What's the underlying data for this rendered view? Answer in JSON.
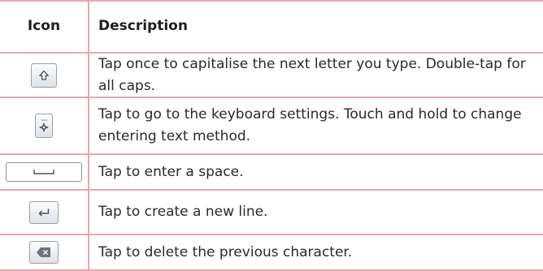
{
  "table": {
    "header": {
      "icon": "Icon",
      "description": "Description"
    },
    "rows": [
      {
        "icon": "shift-icon",
        "description": "Tap once to capitalise the next letter you type. Double-tap for all caps."
      },
      {
        "icon": "settings-key-icon",
        "description": "Tap to go to the keyboard settings. Touch and hold to change entering text method."
      },
      {
        "icon": "space-bar-icon",
        "description": "Tap to enter a space."
      },
      {
        "icon": "enter-key-icon",
        "description": "Tap to create a new line."
      },
      {
        "icon": "delete-key-icon",
        "description": "Tap to delete the previous character."
      }
    ]
  },
  "colors": {
    "border": "#e7a9b2",
    "text": "#2a2a2a"
  }
}
